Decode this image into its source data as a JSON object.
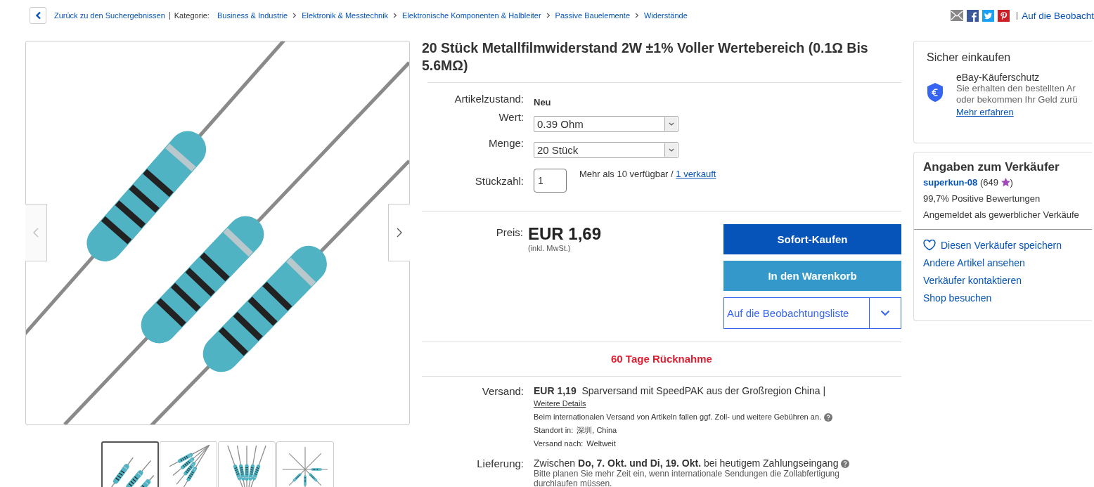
{
  "header": {
    "back_label": "Zurück zu den Suchergebnissen",
    "category_label": "Kategorie:",
    "breadcrumbs": [
      "Business & Industrie",
      "Elektronik & Messtechnik",
      "Elektronische Komponenten & Halbleiter",
      "Passive Bauelemente",
      "Widerstände"
    ],
    "watch_link": "Auf die Beobacht"
  },
  "gallery": {
    "thumbnails": [
      {
        "selected": true
      },
      {
        "selected": false
      },
      {
        "selected": false
      },
      {
        "selected": false
      }
    ]
  },
  "product": {
    "title": "20 Stück Metallfilmwiderstand 2W ±1% Voller Wertebereich (0.1Ω Bis 5.6MΩ)",
    "condition_label": "Artikelzustand:",
    "condition": "Neu",
    "options": [
      {
        "label": "Wert:",
        "value": "0.39 Ohm"
      },
      {
        "label": "Menge:",
        "value": "20 Stück"
      }
    ],
    "quantity_label": "Stückzahl:",
    "quantity": "1",
    "availability": "Mehr als 10 verfügbar /",
    "sold_link": "1 verkauft",
    "price_label": "Preis:",
    "price": "EUR 1,69",
    "price_note": "(inkl. MwSt.)",
    "buy_now": "Sofort-Kaufen",
    "add_to_cart": "In den Warenkorb",
    "watchlist": "Auf die Beobachtungsliste",
    "returns": "60 Tage Rücknahme",
    "shipping_label": "Versand:",
    "shipping_price": "EUR 1,19",
    "shipping_method": "Sparversand mit SpeedPAK aus der Großregion China |",
    "shipping_details_link": "Weitere Details",
    "customs_note": "Beim internationalen Versand von Artikeln fallen ggf. Zoll- und weitere Gebühren an.",
    "location_label": "Standort in:",
    "location": "深圳, China",
    "ships_to_label": "Versand nach:",
    "ships_to": "Weltweit",
    "delivery_label": "Lieferung:",
    "delivery": "Zwischen **Do, 7. Okt. und Di, 19. Okt.** bei heutigem Zahlungseingang",
    "delivery_note": "Bitte planen Sie mehr Zeit ein, wenn internationale Sendungen die Zollabfertigung durchlaufen müssen."
  },
  "buyer_protection": {
    "title": "Sicher einkaufen",
    "heading": "eBay-Käuferschutz",
    "lines": [
      "Sie erhalten den bestellten Ar",
      "oder bekommen Ihr Geld zurü"
    ],
    "link": "Mehr erfahren"
  },
  "seller": {
    "title": "Angaben zum Verkäufer",
    "name": "superkun-08",
    "rating_open": "(649",
    "rating_close": ")",
    "feedback": "99,7% Positive Bewertungen",
    "type": "Angemeldet als gewerblicher Verkäufe",
    "save": "Diesen Verkäufer speichern",
    "links": [
      "Andere Artikel ansehen",
      "Verkäufer kontaktieren",
      "Shop besuchen"
    ]
  }
}
